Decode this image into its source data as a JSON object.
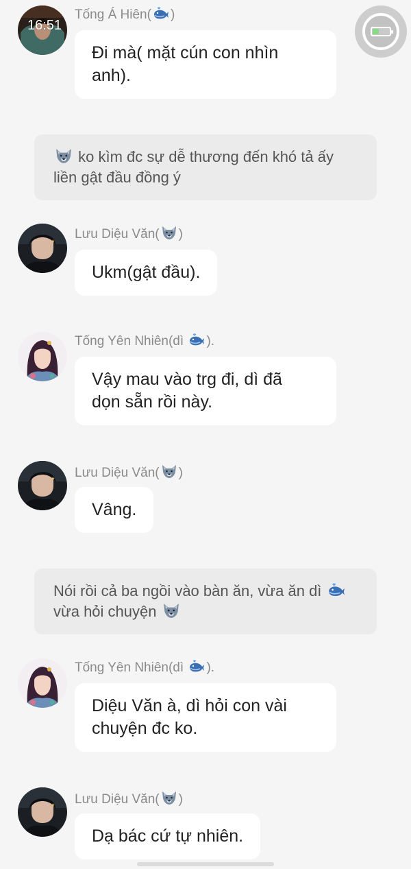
{
  "status_bar": {
    "time": "16:51"
  },
  "colors": {
    "background": "#f5f5f5",
    "bubble": "#ffffff",
    "narration_bg": "#ebebeb",
    "name_text": "#8a8a8a"
  },
  "icons": {
    "whale": "whale-emoji-icon",
    "wolf": "wolf-emoji-icon"
  },
  "messages": [
    {
      "type": "chat",
      "speaker": "Tống Á Hiên(",
      "speaker_suffix": ")",
      "speaker_icon": "whale",
      "text": "Đi mà( mặt cún con nhìn\nanh)."
    },
    {
      "type": "narration",
      "text_a": "ko kìm đc sự dễ thương đến khó tả ấy\nliền gật đầu đồng ý"
    },
    {
      "type": "chat",
      "speaker": "Lưu Diệu Văn(",
      "speaker_suffix": ")",
      "speaker_icon": "wolf",
      "text": "Ukm(gật đầu)."
    },
    {
      "type": "chat",
      "speaker": "Tống Yên Nhiên(dì ",
      "speaker_suffix": ").",
      "speaker_icon": "whale",
      "text": "Vậy mau vào trg đi, dì đã\ndọn sẵn rồi này."
    },
    {
      "type": "chat",
      "speaker": "Lưu Diệu Văn(",
      "speaker_suffix": ")",
      "speaker_icon": "wolf",
      "text": "Vâng."
    },
    {
      "type": "narration",
      "text_a": "Nói rồi cả ba ngồi vào bàn ăn, vừa ăn dì ",
      "text_b": "\nvừa hỏi chuyện "
    },
    {
      "type": "chat",
      "speaker": "Tống Yên Nhiên(dì ",
      "speaker_suffix": ").",
      "speaker_icon": "whale",
      "text": "Diệu Văn à, dì hỏi con vài\nchuyện đc ko."
    },
    {
      "type": "chat",
      "speaker": "Lưu Diệu Văn(",
      "speaker_suffix": ")",
      "speaker_icon": "wolf",
      "text": "Dạ bác cứ tự nhiên."
    }
  ]
}
